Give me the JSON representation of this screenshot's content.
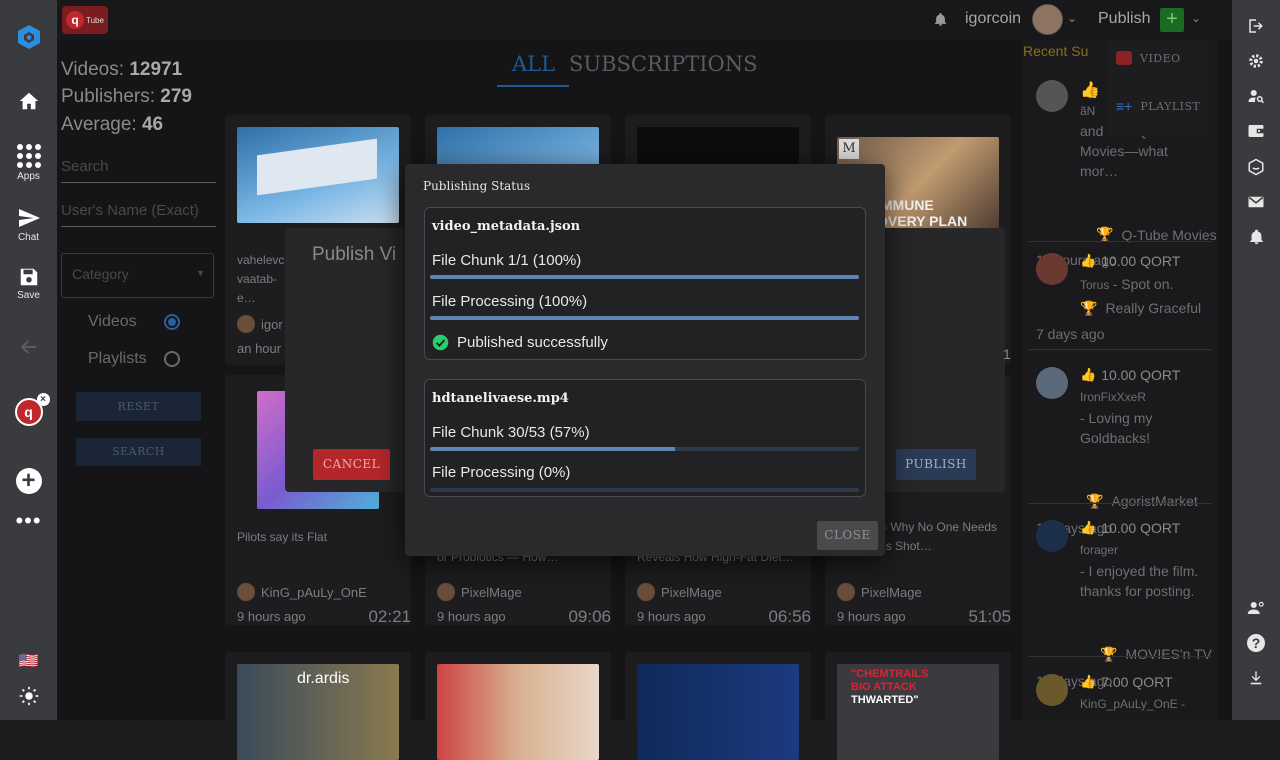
{
  "topbar": {
    "username": "igorcoin",
    "publish_label": "Publish",
    "logo_text": "Tube"
  },
  "left_rail": {
    "apps_label": "Apps",
    "chat_label": "Chat",
    "save_label": "Save",
    "flag": "🇺🇸"
  },
  "stats": {
    "videos_label": "Videos:",
    "videos_value": "12971",
    "publishers_label": "Publishers:",
    "publishers_value": "279",
    "average_label": "Average:",
    "average_value": "46"
  },
  "filters": {
    "search_placeholder": "Search",
    "user_placeholder": "User's Name (Exact)",
    "category_placeholder": "Category",
    "radio_videos": "Videos",
    "radio_playlists": "Playlists",
    "reset_label": "RESET",
    "search_label": "SEARCH"
  },
  "tabs": {
    "all": "ALL",
    "subscriptions": "SUBSCRIPTIONS"
  },
  "cards": [
    {
      "title": "vahelevc… vaatab-e…",
      "author": "igor",
      "time": "an hour",
      "duration": ""
    },
    {
      "title": "Pilots say its Flat",
      "author": "KinG_pAuLy_OnE",
      "time": "9 hours ago",
      "duration": "02:21"
    },
    {
      "title": "or Probiotics — How…",
      "author": "PixelMage",
      "time": "9 hours ago",
      "duration": "09:06"
    },
    {
      "title": "Reveals How High-Fat Diet…",
      "author": "PixelMage",
      "time": "9 hours ago",
      "duration": "06:56"
    },
    {
      "title": "… - 037 - Why No One Needs a Measles Shot…",
      "author": "PixelMage",
      "time": "9 hours ago",
      "duration": "51:05"
    }
  ],
  "thumb_text": {
    "immune": "IMMUNE",
    "recovery": "OVERY PLAN",
    "m": "M",
    "drardis": "dr.ardis",
    "chemtrails": "\"CHEMTRAILS",
    "bioattack": "BIO ATTACK",
    "thwarted": "THWARTED\""
  },
  "recent": {
    "header": "Recent Su",
    "menu_video": "VIDEO",
    "menu_playlist": "PLAYLIST",
    "items": [
      {
        "amount": "",
        "user": "ãN",
        "comment": "and how Q-Tube Movies—what mor…",
        "target": "Q-Tube Movies",
        "time": "11 hours ago"
      },
      {
        "amount": "10.00 QORT",
        "user": "Torus",
        "comment": "- Spot on.",
        "target": "Really Graceful",
        "time": "7 days ago"
      },
      {
        "amount": "10.00 QORT",
        "user": "IronFixXxeR",
        "comment": "- Loving my Goldbacks!",
        "target": "AgoristMarket",
        "time": "13 days ago"
      },
      {
        "amount": "10.00 QORT",
        "user": "forager",
        "comment": "- I enjoyed the film. thanks for posting.",
        "target": "MOVIES'n TV",
        "time": "14 days ago"
      },
      {
        "amount": "7.00 QORT",
        "user": "KinG_pAuLy_OnE",
        "comment": "-",
        "target": "",
        "time": ""
      }
    ]
  },
  "publish_modal": {
    "title": "Publish Vi",
    "cancel_label": "CANCEL",
    "publish_label": "PUBLISH",
    "side_number": "1"
  },
  "status_modal": {
    "title": "Publishing Status",
    "close_label": "CLOSE",
    "files": [
      {
        "name": "video_metadata.json",
        "chunk_text": "File Chunk 1/1 (100%)",
        "chunk_progress": 1.0,
        "processing_text": "File Processing (100%)",
        "processing_progress": 1.0,
        "success_text": "Published successfully"
      },
      {
        "name": "hdtanelivaese.mp4",
        "chunk_text": "File Chunk 30/53 (57%)",
        "chunk_progress": 0.57,
        "processing_text": "File Processing (0%)",
        "processing_progress": 0.0
      }
    ]
  },
  "colors": {
    "accent_blue": "#2196f3",
    "success_green": "#2ecc71",
    "cancel_red": "#b3262a",
    "progress_fill": "#5f84b8",
    "publish_button": "#2c3b55"
  }
}
